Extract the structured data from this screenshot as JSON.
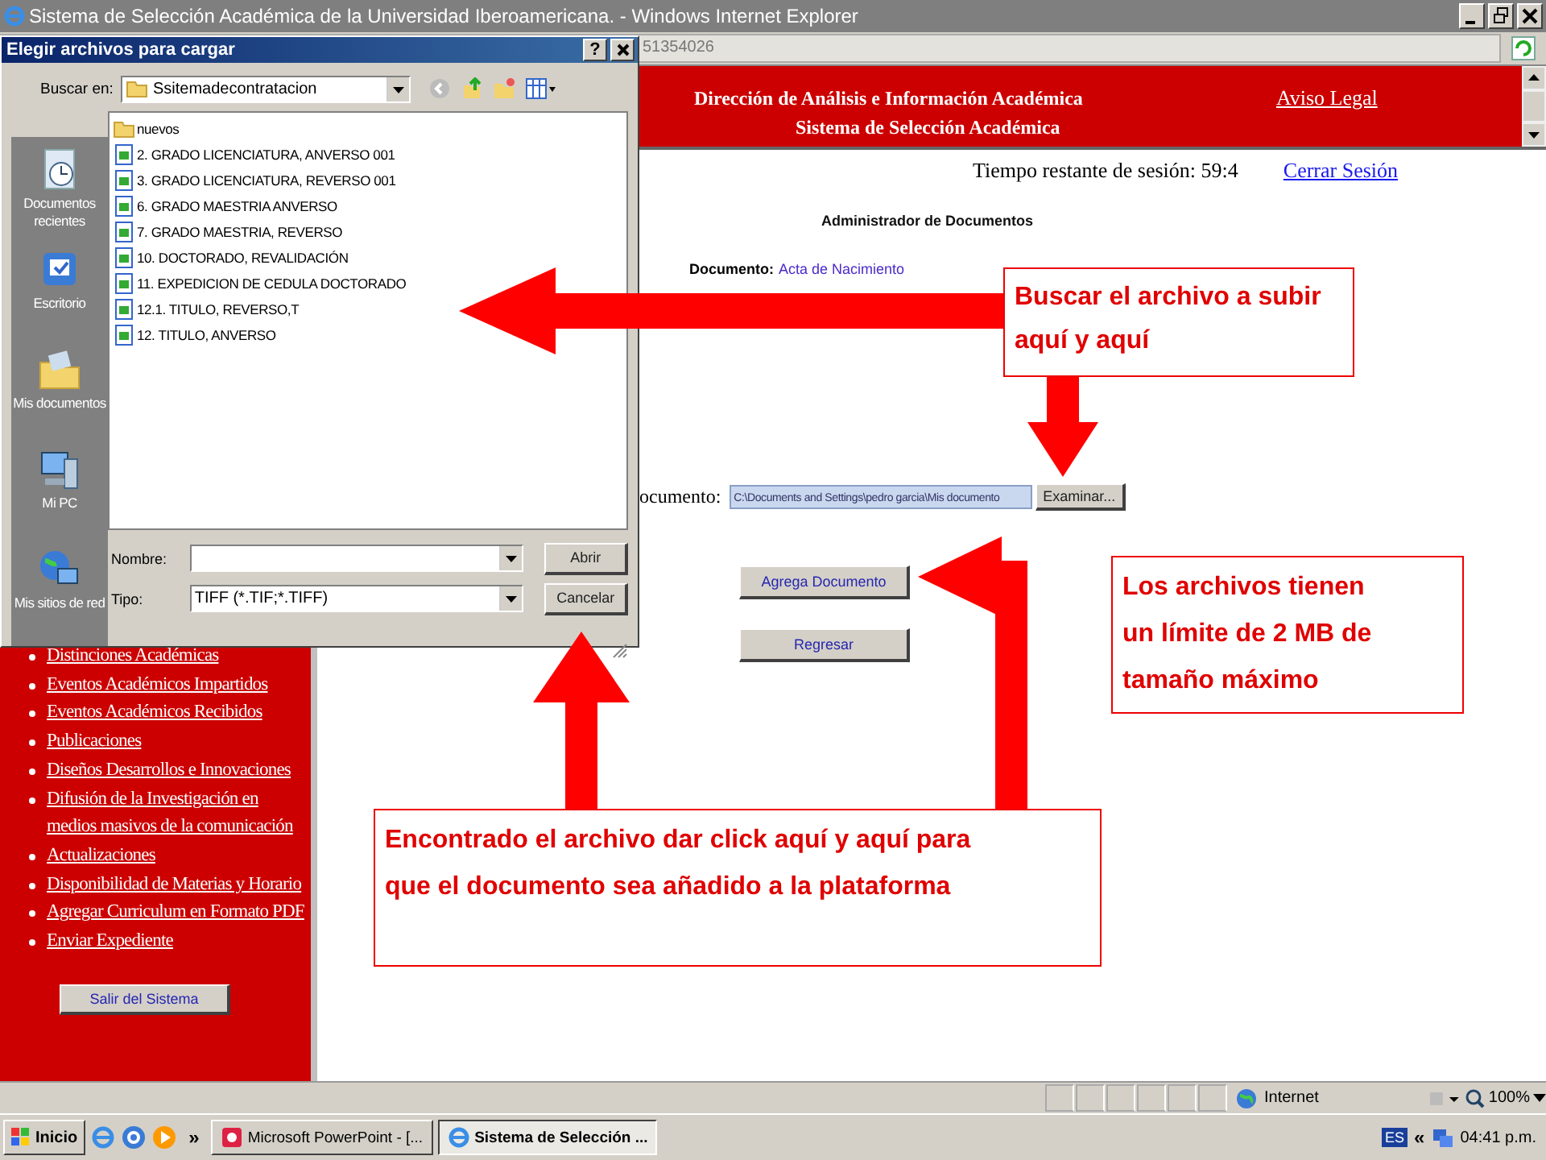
{
  "window": {
    "title": "Sistema de Selección Académica de la Universidad Iberoamericana. - Windows Internet Explorer"
  },
  "address_bar": {
    "value": "51354026"
  },
  "header": {
    "lines": [
      "Dirección de Análisis e Información Académica",
      "Sistema de Selección Académica"
    ],
    "link": "Aviso Legal"
  },
  "sidebar": {
    "items": [
      "Distinciones Académicas",
      "Eventos Académicos Impartidos",
      "Eventos Académicos Recibidos",
      "Publicaciones",
      "Diseños Desarrollos e Innovaciones",
      "Difusión de la Investigación en medios masivos de la comunicación",
      "Actualizaciones",
      "Disponibilidad de Materias y Horario",
      "Agregar Curriculum en Formato PDF",
      "Enviar Expediente"
    ],
    "button": "Salir del Sistema"
  },
  "session": {
    "label": "Tiempo restante de sesión: 59:4",
    "link": "Cerrar Sesión"
  },
  "content": {
    "heading": "Administrador de Documentos",
    "document_label": "Documento:",
    "document_value": "Acta de Nacimiento",
    "file_label": "ocumento:",
    "file_value": "C:\\Documents and Settings\\pedro garcia\\Mis documento",
    "browse_button": "Examinar...",
    "buttons": [
      "Agrega Documento",
      "Regresar"
    ]
  },
  "status_bar": {
    "zone": "Internet",
    "zoom": "100%"
  },
  "taskbar": {
    "start": "Inicio",
    "more": "»",
    "tasks": [
      {
        "label": "Microsoft PowerPoint - [...",
        "selected": false
      },
      {
        "label": "Sistema de Selección ...",
        "selected": true
      }
    ],
    "language": "ES",
    "tray_more": "«",
    "clock": "04:41 p.m."
  },
  "dialog": {
    "title": "Elegir archivos para cargar",
    "help": "?",
    "look_in_label": "Buscar en:",
    "folder": "Ssitemadecontratacion",
    "places": [
      {
        "label": "Documentos recientes",
        "kind": "recent"
      },
      {
        "label": "Escritorio",
        "kind": "desktop"
      },
      {
        "label": "Mis documentos",
        "kind": "documents"
      },
      {
        "label": "Mi PC",
        "kind": "computer"
      },
      {
        "label": "Mis sitios de red",
        "kind": "network"
      }
    ],
    "files": [
      {
        "name": "nuevos",
        "kind": "folder"
      },
      {
        "name": "2. GRADO LICENCIATURA, ANVERSO 001",
        "kind": "image"
      },
      {
        "name": "3. GRADO LICENCIATURA, REVERSO 001",
        "kind": "image"
      },
      {
        "name": "6. GRADO MAESTRIA ANVERSO",
        "kind": "image"
      },
      {
        "name": "7. GRADO MAESTRIA, REVERSO",
        "kind": "image"
      },
      {
        "name": "10. DOCTORADO, REVALIDACIÓN",
        "kind": "image"
      },
      {
        "name": "11. EXPEDICION DE CEDULA DOCTORADO",
        "kind": "image"
      },
      {
        "name": "12.1. TITULO, REVERSO,T",
        "kind": "image"
      },
      {
        "name": "12. TITULO,  ANVERSO",
        "kind": "image"
      }
    ],
    "name_label": "Nombre:",
    "type_label": "Tipo:",
    "type_value": "TIFF (*.TIF;*.TIFF)",
    "buttons": [
      "Abrir",
      "Cancelar"
    ]
  },
  "callouts": [
    "Buscar el archivo a subir aquí y aquí",
    "Los archivos tienen un límite de 2 MB de tamaño máximo",
    "Encontrado el archivo dar click aquí y aquí para que el documento sea añadido a la plataforma"
  ]
}
